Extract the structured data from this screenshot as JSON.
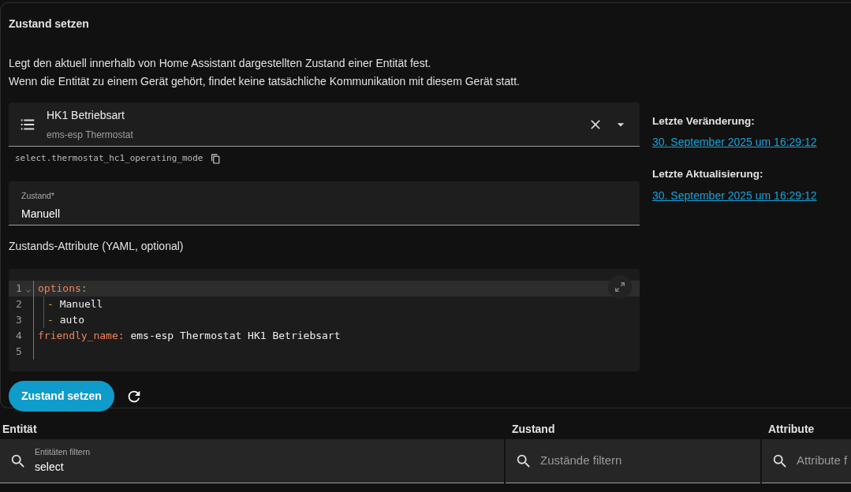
{
  "card": {
    "title": "Zustand setzen",
    "description": [
      "Legt den aktuell innerhalb von Home Assistant dargestellten Zustand einer Entität fest.",
      "Wenn die Entität zu einem Gerät gehört, findet keine tatsächliche Kommunikation mit diesem Gerät statt."
    ],
    "entity_picker": {
      "name": "HK1 Betriebsart",
      "device": "ems-esp Thermostat"
    },
    "entity_id": "select.thermostat_hc1_operating_mode",
    "state_field": {
      "label": "Zustand*",
      "value": "Manuell"
    },
    "attributes_label": "Zustands-Attribute (YAML, optional)",
    "code_lines": [
      {
        "number": "1",
        "active": true,
        "foldable": true,
        "indented": false,
        "tokens": [
          {
            "kind": "key",
            "text": "options"
          },
          {
            "kind": "punct",
            "text": ":"
          }
        ]
      },
      {
        "number": "2",
        "active": false,
        "foldable": false,
        "indented": true,
        "tokens": [
          {
            "kind": "punct",
            "text": "- "
          },
          {
            "kind": "value",
            "text": "Manuell"
          }
        ]
      },
      {
        "number": "3",
        "active": false,
        "foldable": false,
        "indented": true,
        "tokens": [
          {
            "kind": "punct",
            "text": "- "
          },
          {
            "kind": "value",
            "text": "auto"
          }
        ]
      },
      {
        "number": "4",
        "active": false,
        "foldable": false,
        "indented": false,
        "tokens": [
          {
            "kind": "key",
            "text": "friendly_name"
          },
          {
            "kind": "punct",
            "text": ": "
          },
          {
            "kind": "value",
            "text": "ems-esp Thermostat HK1 Betriebsart"
          }
        ]
      },
      {
        "number": "5",
        "active": false,
        "foldable": false,
        "indented": false
      }
    ],
    "submit_button": "Zustand setzen",
    "info": [
      {
        "label": "Letzte Veränderung:",
        "value": "30. September 2025 um 16:29:12"
      },
      {
        "label": "Letzte Aktualisierung:",
        "value": "30. September 2025 um 16:29:12"
      }
    ]
  },
  "table": {
    "columns": [
      {
        "title": "Entität",
        "filter": {
          "label": "Entitäten filtern",
          "value": "select"
        }
      },
      {
        "title": "Zustand",
        "filter": {
          "placeholder": "Zustände filtern"
        }
      },
      {
        "title": "Attribute",
        "filter": {
          "placeholder": "Attribute f"
        }
      }
    ]
  }
}
